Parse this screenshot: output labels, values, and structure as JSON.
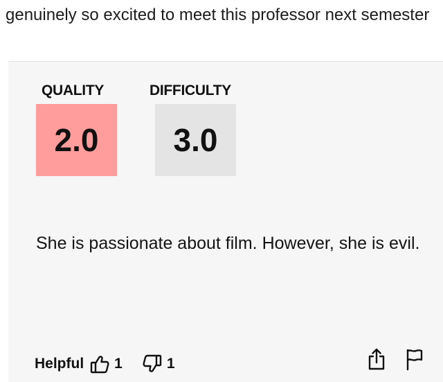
{
  "tweet": {
    "text": "genuinely so excited to meet this professor next semester"
  },
  "rating": {
    "quality_label": "QUALITY",
    "quality_value": "2.0",
    "difficulty_label": "DIFFICULTY",
    "difficulty_value": "3.0",
    "quality_color": "#ff9c9c",
    "difficulty_color": "#e4e4e4"
  },
  "review": {
    "comment": "She is passionate about film. However, she is evil."
  },
  "footer": {
    "helpful_label": "Helpful",
    "thumbs_up_count": "1",
    "thumbs_down_count": "1",
    "icons": [
      "thumbs-up-icon",
      "thumbs-down-icon",
      "share-icon",
      "flag-icon"
    ]
  }
}
